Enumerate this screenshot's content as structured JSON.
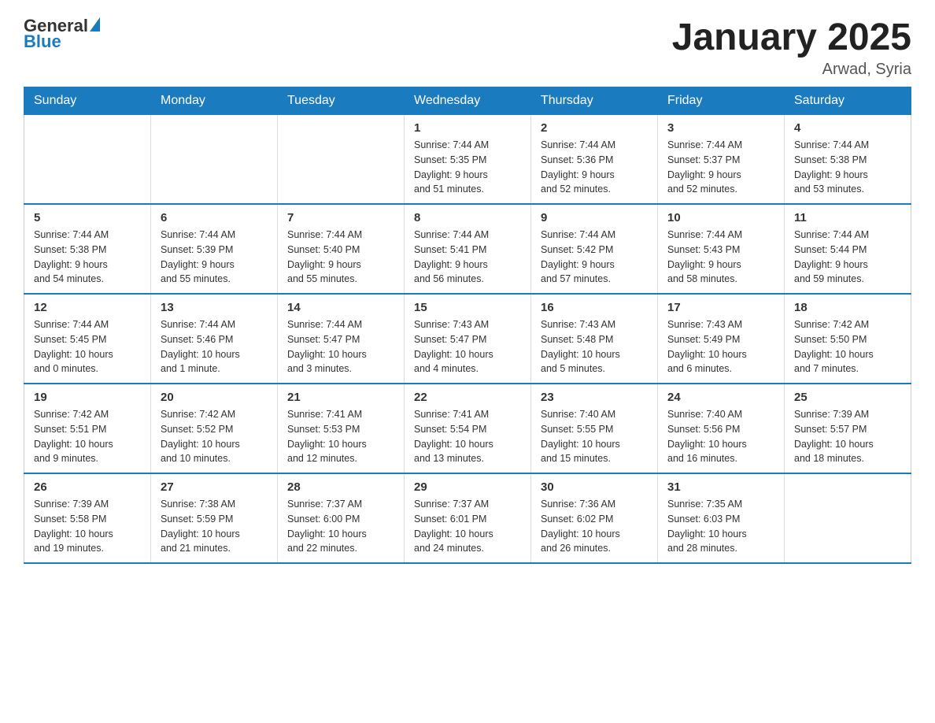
{
  "header": {
    "logo": {
      "general": "General",
      "blue": "Blue"
    },
    "title": "January 2025",
    "location": "Arwad, Syria"
  },
  "calendar": {
    "days_of_week": [
      "Sunday",
      "Monday",
      "Tuesday",
      "Wednesday",
      "Thursday",
      "Friday",
      "Saturday"
    ],
    "weeks": [
      [
        {
          "day": "",
          "info": ""
        },
        {
          "day": "",
          "info": ""
        },
        {
          "day": "",
          "info": ""
        },
        {
          "day": "1",
          "info": "Sunrise: 7:44 AM\nSunset: 5:35 PM\nDaylight: 9 hours\nand 51 minutes."
        },
        {
          "day": "2",
          "info": "Sunrise: 7:44 AM\nSunset: 5:36 PM\nDaylight: 9 hours\nand 52 minutes."
        },
        {
          "day": "3",
          "info": "Sunrise: 7:44 AM\nSunset: 5:37 PM\nDaylight: 9 hours\nand 52 minutes."
        },
        {
          "day": "4",
          "info": "Sunrise: 7:44 AM\nSunset: 5:38 PM\nDaylight: 9 hours\nand 53 minutes."
        }
      ],
      [
        {
          "day": "5",
          "info": "Sunrise: 7:44 AM\nSunset: 5:38 PM\nDaylight: 9 hours\nand 54 minutes."
        },
        {
          "day": "6",
          "info": "Sunrise: 7:44 AM\nSunset: 5:39 PM\nDaylight: 9 hours\nand 55 minutes."
        },
        {
          "day": "7",
          "info": "Sunrise: 7:44 AM\nSunset: 5:40 PM\nDaylight: 9 hours\nand 55 minutes."
        },
        {
          "day": "8",
          "info": "Sunrise: 7:44 AM\nSunset: 5:41 PM\nDaylight: 9 hours\nand 56 minutes."
        },
        {
          "day": "9",
          "info": "Sunrise: 7:44 AM\nSunset: 5:42 PM\nDaylight: 9 hours\nand 57 minutes."
        },
        {
          "day": "10",
          "info": "Sunrise: 7:44 AM\nSunset: 5:43 PM\nDaylight: 9 hours\nand 58 minutes."
        },
        {
          "day": "11",
          "info": "Sunrise: 7:44 AM\nSunset: 5:44 PM\nDaylight: 9 hours\nand 59 minutes."
        }
      ],
      [
        {
          "day": "12",
          "info": "Sunrise: 7:44 AM\nSunset: 5:45 PM\nDaylight: 10 hours\nand 0 minutes."
        },
        {
          "day": "13",
          "info": "Sunrise: 7:44 AM\nSunset: 5:46 PM\nDaylight: 10 hours\nand 1 minute."
        },
        {
          "day": "14",
          "info": "Sunrise: 7:44 AM\nSunset: 5:47 PM\nDaylight: 10 hours\nand 3 minutes."
        },
        {
          "day": "15",
          "info": "Sunrise: 7:43 AM\nSunset: 5:47 PM\nDaylight: 10 hours\nand 4 minutes."
        },
        {
          "day": "16",
          "info": "Sunrise: 7:43 AM\nSunset: 5:48 PM\nDaylight: 10 hours\nand 5 minutes."
        },
        {
          "day": "17",
          "info": "Sunrise: 7:43 AM\nSunset: 5:49 PM\nDaylight: 10 hours\nand 6 minutes."
        },
        {
          "day": "18",
          "info": "Sunrise: 7:42 AM\nSunset: 5:50 PM\nDaylight: 10 hours\nand 7 minutes."
        }
      ],
      [
        {
          "day": "19",
          "info": "Sunrise: 7:42 AM\nSunset: 5:51 PM\nDaylight: 10 hours\nand 9 minutes."
        },
        {
          "day": "20",
          "info": "Sunrise: 7:42 AM\nSunset: 5:52 PM\nDaylight: 10 hours\nand 10 minutes."
        },
        {
          "day": "21",
          "info": "Sunrise: 7:41 AM\nSunset: 5:53 PM\nDaylight: 10 hours\nand 12 minutes."
        },
        {
          "day": "22",
          "info": "Sunrise: 7:41 AM\nSunset: 5:54 PM\nDaylight: 10 hours\nand 13 minutes."
        },
        {
          "day": "23",
          "info": "Sunrise: 7:40 AM\nSunset: 5:55 PM\nDaylight: 10 hours\nand 15 minutes."
        },
        {
          "day": "24",
          "info": "Sunrise: 7:40 AM\nSunset: 5:56 PM\nDaylight: 10 hours\nand 16 minutes."
        },
        {
          "day": "25",
          "info": "Sunrise: 7:39 AM\nSunset: 5:57 PM\nDaylight: 10 hours\nand 18 minutes."
        }
      ],
      [
        {
          "day": "26",
          "info": "Sunrise: 7:39 AM\nSunset: 5:58 PM\nDaylight: 10 hours\nand 19 minutes."
        },
        {
          "day": "27",
          "info": "Sunrise: 7:38 AM\nSunset: 5:59 PM\nDaylight: 10 hours\nand 21 minutes."
        },
        {
          "day": "28",
          "info": "Sunrise: 7:37 AM\nSunset: 6:00 PM\nDaylight: 10 hours\nand 22 minutes."
        },
        {
          "day": "29",
          "info": "Sunrise: 7:37 AM\nSunset: 6:01 PM\nDaylight: 10 hours\nand 24 minutes."
        },
        {
          "day": "30",
          "info": "Sunrise: 7:36 AM\nSunset: 6:02 PM\nDaylight: 10 hours\nand 26 minutes."
        },
        {
          "day": "31",
          "info": "Sunrise: 7:35 AM\nSunset: 6:03 PM\nDaylight: 10 hours\nand 28 minutes."
        },
        {
          "day": "",
          "info": ""
        }
      ]
    ]
  }
}
